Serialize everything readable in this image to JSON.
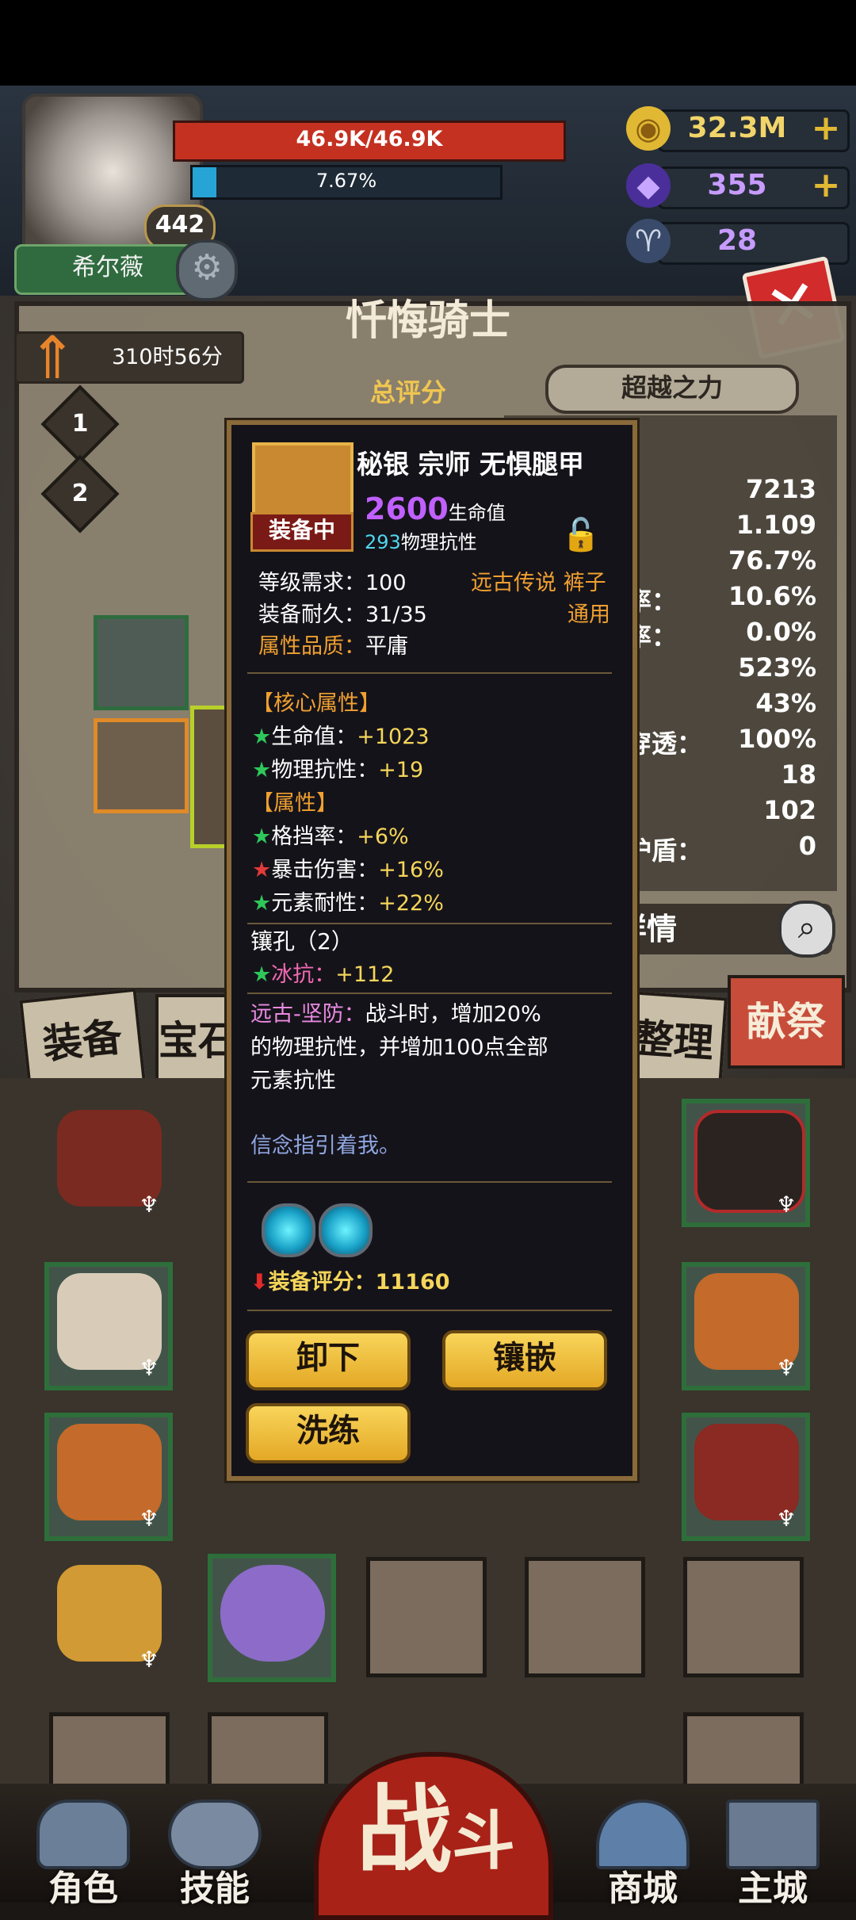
{
  "player": {
    "name": "希尔薇",
    "level": "442",
    "hp_text": "46.9K/46.9K",
    "exp_text": "7.67%",
    "exp_fraction": 0.0767
  },
  "resources": [
    {
      "name": "gold",
      "icon": "gold-coin-icon",
      "value": "32.3M",
      "plus": "+"
    },
    {
      "name": "gem",
      "icon": "purple-crystal-icon",
      "value": "355",
      "plus": "+"
    },
    {
      "name": "horn",
      "icon": "ram-horn-icon",
      "value": "28"
    }
  ],
  "character_title": "忏悔骑士",
  "timer_text": "310时56分",
  "slots": [
    "1",
    "2"
  ],
  "score_label": "总评分",
  "beyond_label": "超越之力",
  "stats": [
    {
      "label": "",
      "value": "7213"
    },
    {
      "label": "",
      "value": "1.109"
    },
    {
      "label": "",
      "value": "76.7%"
    },
    {
      "label": "率：",
      "value": "10.6%"
    },
    {
      "label": "率：",
      "value": "0.0%"
    },
    {
      "label": "：",
      "value": "523%"
    },
    {
      "label": "",
      "value": "43%"
    },
    {
      "label": "穿透：",
      "value": "100%"
    },
    {
      "label": "",
      "value": "18"
    },
    {
      "label": "",
      "value": "102"
    },
    {
      "label": "护盾：",
      "value": "0"
    }
  ],
  "stats_detail_label": "性详情",
  "tabs": {
    "equip": "装备",
    "treasure": "宝石",
    "sort": "整理",
    "sacrifice": "献祭"
  },
  "popup": {
    "title": "秘银 宗师 无惧腿甲",
    "equipped_badge": "装备中",
    "main_value": "2600",
    "main_value_label": "生命值",
    "sub_value": "293",
    "sub_value_label": "物理抗性",
    "level_req": "等级需求：100",
    "durability": "装备耐久：31/35",
    "quality_label": "属性品质：",
    "quality_value": "平庸",
    "rarity_type": "远古传说 裤子",
    "usage": "通用",
    "core_header": "【核心属性】",
    "core_attrs": [
      {
        "label": "生命值：",
        "value": "+1023"
      },
      {
        "label": "物理抗性：",
        "value": "+19"
      }
    ],
    "attr_header": "【属性】",
    "attrs": [
      {
        "label": "格挡率：",
        "value": "+6%",
        "star": "green"
      },
      {
        "label": "暴击伤害：",
        "value": "+16%",
        "star": "red"
      },
      {
        "label": "元素耐性：",
        "value": "+22%",
        "star": "green"
      }
    ],
    "socket_header": "镶孔（2）",
    "socket_attr_label": "冰抗：",
    "socket_attr_value": "+112",
    "skill_name": "远古-坚防：",
    "skill_desc_1": "战斗时，增加20%",
    "skill_desc_2": "的物理抗性，并增加100点全部",
    "skill_desc_3": "元素抗性",
    "flavor": "信念指引着我。",
    "score_label": "装备评分：",
    "score_value": "11160",
    "buttons": {
      "unequip": "卸下",
      "inlay": "镶嵌",
      "reforge": "洗练"
    }
  },
  "nav": {
    "role": "角色",
    "skill": "技能",
    "fight_1": "战",
    "fight_2": "斗",
    "shop": "商城",
    "city": "主城"
  },
  "colors": {
    "hp": "#c43121",
    "exp": "#27a4d6",
    "gold": "#e0b833",
    "legendary": "#f0a030",
    "purple_value": "#c060ff",
    "cyan_value": "#4fd6ee",
    "green_value": "#f5d65a"
  }
}
